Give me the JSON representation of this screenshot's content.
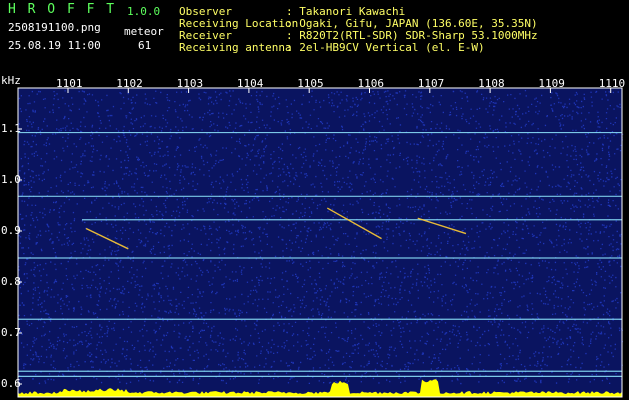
{
  "app": {
    "name": "H R O F F T",
    "version": "1.0.0",
    "filename": "2508191100.png",
    "datetime": "25.08.19 11:00",
    "meteor_label": "meteor",
    "meteor_count": "61"
  },
  "info": [
    {
      "label": "Observer",
      "value": ": Takanori Kawachi"
    },
    {
      "label": "Receiving Location",
      "value": ": Ogaki, Gifu, JAPAN (136.60E, 35.35N)"
    },
    {
      "label": "Receiver",
      "value": ": R820T2(RTL-SDR) SDR-Sharp 53.1000MHz"
    },
    {
      "label": "Receiving antenna",
      "value": ": 2el-HB9CV Vertical (el. E-W)"
    }
  ],
  "axis": {
    "y_unit": "kHz",
    "x_ticks": [
      "1101",
      "1102",
      "1103",
      "1104",
      "1105",
      "1106",
      "1107",
      "1108",
      "1109",
      "1110"
    ],
    "y_ticks": [
      "1.1",
      "1.0",
      "0.9",
      "0.8",
      "0.7",
      "0.6"
    ]
  },
  "chart_data": {
    "type": "heatmap",
    "ylabel": "kHz",
    "x_ticks": [
      "1101",
      "1102",
      "1103",
      "1104",
      "1105",
      "1106",
      "1107",
      "1108",
      "1109",
      "1110"
    ],
    "ylim": [
      0.58,
      1.17
    ],
    "carrier_lines_khz": [
      1.093,
      0.968,
      0.922,
      0.847,
      0.727,
      0.625,
      0.615
    ],
    "meteor_echoes": [
      {
        "start_min": 1101.3,
        "end_min": 1102.0,
        "f_start": 0.905,
        "f_end": 0.865
      },
      {
        "start_min": 1105.3,
        "end_min": 1106.2,
        "f_start": 0.945,
        "f_end": 0.885
      },
      {
        "start_min": 1106.8,
        "end_min": 1107.6,
        "f_start": 0.925,
        "f_end": 0.895
      }
    ],
    "colors": {
      "background": "#0a1460",
      "noise": "#3050ff",
      "line": "#8fe8ff",
      "echo": "#ffcc33",
      "bottom_bar": "#ffff00"
    }
  }
}
